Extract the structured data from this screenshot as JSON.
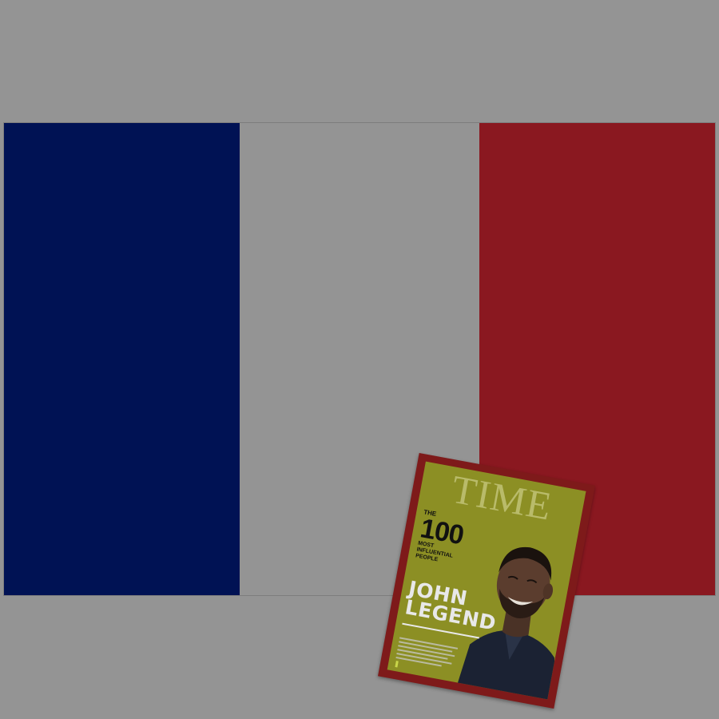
{
  "flag": {
    "colors": {
      "blue": "#001254",
      "white": "#949494",
      "red": "#8a1820"
    }
  },
  "magazine": {
    "masthead": "TIME",
    "the": "THE",
    "hundred": "100",
    "most_influential": "MOST INFLUENTIAL PEOPLE",
    "name_line1": "JOHN",
    "name_line2": "LEGEND",
    "colors": {
      "border": "#7e1a1a",
      "background": "#8c8f24"
    }
  }
}
